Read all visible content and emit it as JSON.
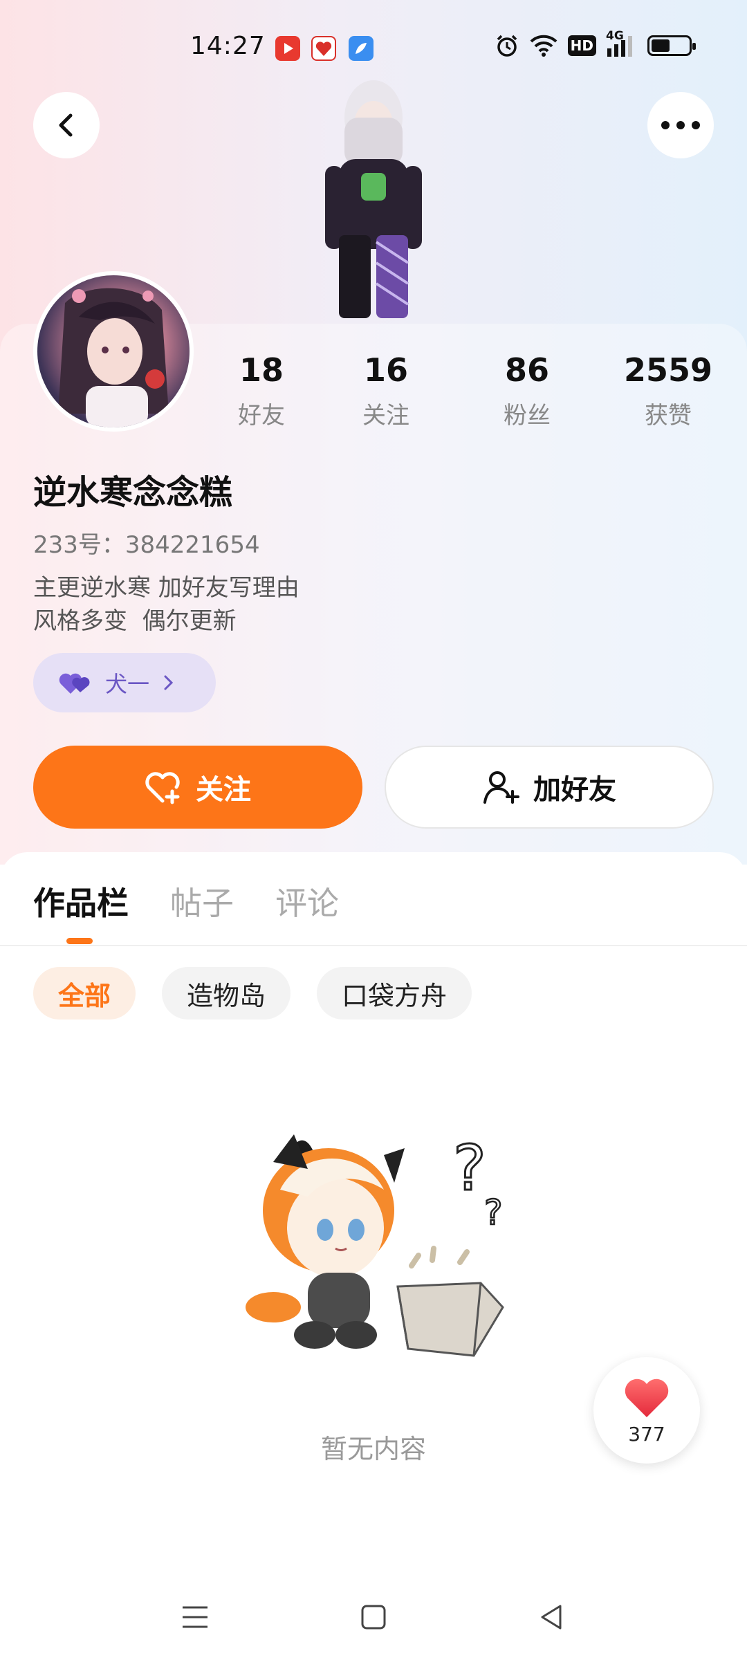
{
  "status_bar": {
    "time": "14:27",
    "icons": [
      "video-app-icon",
      "gift-app-icon",
      "feather-app-icon",
      "alarm-icon",
      "wifi-icon",
      "hd-icon",
      "4g-signal-icon",
      "battery-icon"
    ],
    "hd_label": "HD",
    "network_label": "4G",
    "battery_level": 0.5
  },
  "header": {
    "back_icon": "back-arrow-icon",
    "more_icon": "more-dots-icon"
  },
  "profile": {
    "nickname": "逆水寒念念糕",
    "uid": "233号：384221654",
    "bio_line1": "主更逆水寒 加好友写理由",
    "bio_line2": "风格多变  偶尔更新",
    "tag_label": "犬一",
    "stats": [
      {
        "value": "18",
        "label": "好友"
      },
      {
        "value": "16",
        "label": "关注"
      },
      {
        "value": "86",
        "label": "粉丝"
      },
      {
        "value": "2559",
        "label": "获赞"
      }
    ]
  },
  "actions": {
    "follow_label": "关注",
    "add_friend_label": "加好友"
  },
  "tabs": [
    {
      "label": "作品栏",
      "active": true
    },
    {
      "label": "帖子",
      "active": false
    },
    {
      "label": "评论",
      "active": false
    }
  ],
  "filters": [
    {
      "label": "全部",
      "active": true
    },
    {
      "label": "造物岛",
      "active": false
    },
    {
      "label": "口袋方舟",
      "active": false
    }
  ],
  "empty_state": {
    "text": "暂无内容"
  },
  "like_button": {
    "count": "377"
  },
  "colors": {
    "accent": "#fd7518",
    "tag_purple": "#6b57c4",
    "like_red": "#f0384a"
  }
}
